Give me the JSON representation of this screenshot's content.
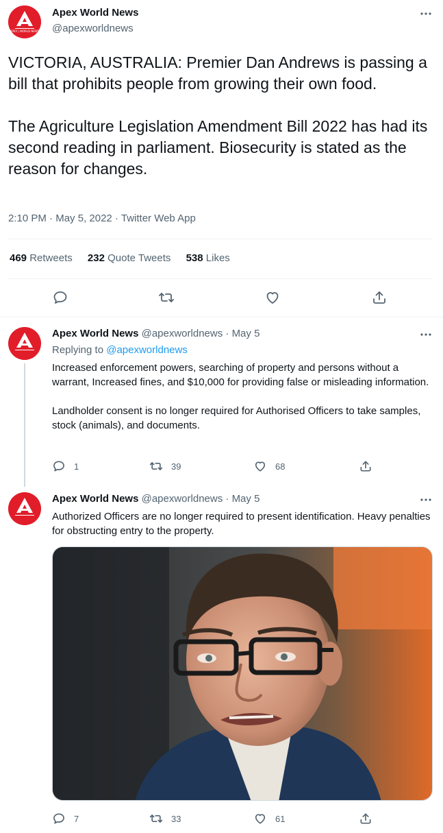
{
  "main_tweet": {
    "author_name": "Apex World News",
    "handle": "@apexworldnews",
    "avatar_text": "APEX | WORLD NEWS",
    "text": "VICTORIA, AUSTRALIA: Premier Dan Andrews is passing a bill that prohibits people from growing their own food.\n\nThe Agriculture Legislation Amendment Bill 2022 has had its second reading in parliament. Biosecurity is stated as the reason for changes.",
    "time": "2:10 PM",
    "sep": "·",
    "date": "May 5, 2022",
    "source": "Twitter Web App",
    "stats": [
      {
        "count": "469",
        "label": "Retweets"
      },
      {
        "count": "232",
        "label": "Quote Tweets"
      },
      {
        "count": "538",
        "label": "Likes"
      }
    ],
    "actions": [
      "reply-icon",
      "retweet-icon",
      "like-icon",
      "share-icon"
    ]
  },
  "replies": [
    {
      "author_name": "Apex World News",
      "handle": "@apexworldnews",
      "sep": "·",
      "date": "May 5",
      "replying_prefix": "Replying to",
      "replying_to": "@apexworldnews",
      "text": "Increased enforcement powers, searching of property and persons without a warrant, Increased fines, and $10,000 for providing false or misleading information.\n\nLandholder consent is no longer required for Authorised Officers to take samples, stock (animals), and documents.",
      "reply_count": "1",
      "retweet_count": "39",
      "like_count": "68"
    },
    {
      "author_name": "Apex World News",
      "handle": "@apexworldnews",
      "sep": "·",
      "date": "May 5",
      "text": "Authorized Officers are no longer required to present identification. Heavy penalties for obstructing entry to the property.",
      "reply_count": "7",
      "retweet_count": "33",
      "like_count": "61",
      "media": "photo of a man with glasses speaking"
    }
  ],
  "colors": {
    "brand_red": "#e11d2a",
    "text": "#0f1419",
    "muted": "#536471",
    "link": "#1d9bf0",
    "divider": "#eff3f4"
  }
}
